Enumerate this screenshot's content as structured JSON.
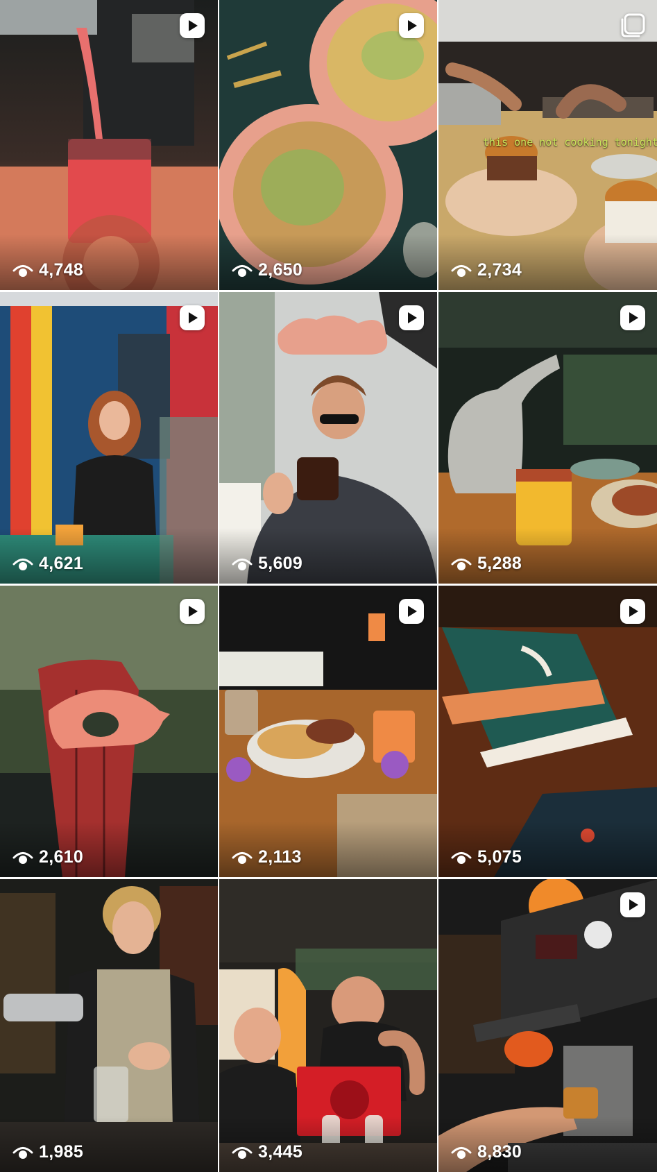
{
  "grid": {
    "posts": [
      {
        "views": "4,748",
        "kind": "reel",
        "icon": "reel-play-icon"
      },
      {
        "views": "2,650",
        "kind": "reel",
        "icon": "reel-play-icon"
      },
      {
        "views": "2,734",
        "kind": "carousel",
        "icon": "carousel-icon",
        "overlay_text": "this one not cooking tonight"
      },
      {
        "views": "4,621",
        "kind": "reel",
        "icon": "reel-play-icon"
      },
      {
        "views": "5,609",
        "kind": "reel",
        "icon": "reel-play-icon"
      },
      {
        "views": "5,288",
        "kind": "reel",
        "icon": "reel-play-icon"
      },
      {
        "views": "2,610",
        "kind": "reel",
        "icon": "reel-play-icon"
      },
      {
        "views": "2,113",
        "kind": "reel",
        "icon": "reel-play-icon"
      },
      {
        "views": "5,075",
        "kind": "reel",
        "icon": "reel-play-icon"
      },
      {
        "views": "1,985",
        "kind": "reel",
        "icon": "none"
      },
      {
        "views": "3,445",
        "kind": "reel",
        "icon": "none"
      },
      {
        "views": "8,830",
        "kind": "reel",
        "icon": "reel-play-icon"
      }
    ],
    "view_count_icon": "eye-icon"
  },
  "colors": {
    "overlay_text": "#ffffff",
    "badge": "#ffffff",
    "grid_gap": "#ffffff"
  }
}
